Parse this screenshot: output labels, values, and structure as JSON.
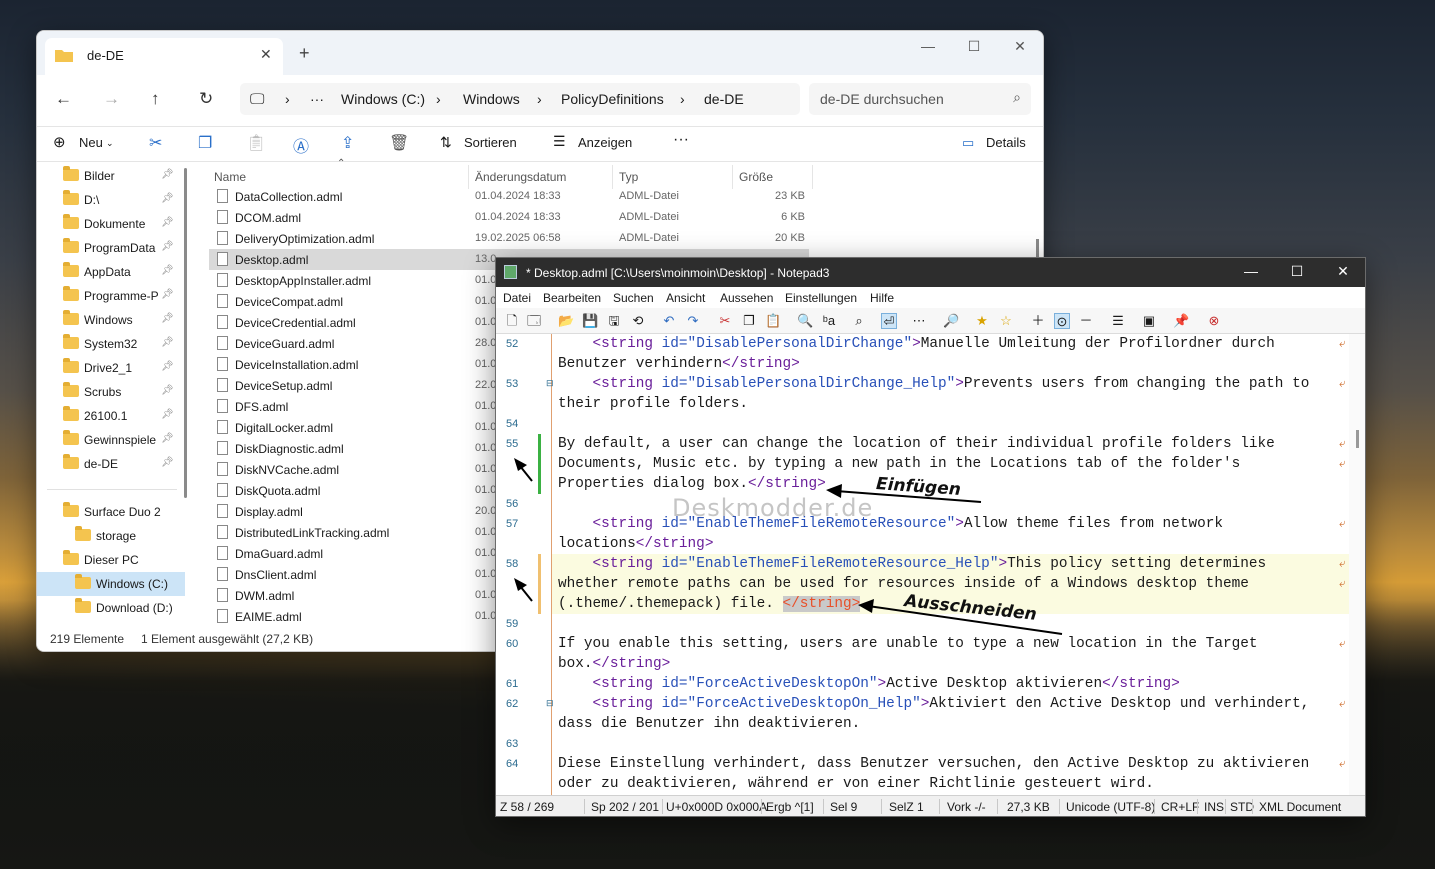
{
  "explorer": {
    "tab_title": "de-DE",
    "breadcrumb": [
      "Windows (C:)",
      "Windows",
      "PolicyDefinitions",
      "de-DE"
    ],
    "search_placeholder": "de-DE durchsuchen",
    "commands": {
      "new": "Neu",
      "sort": "Sortieren",
      "view": "Anzeigen",
      "details": "Details",
      "more": "···"
    },
    "sidebar": [
      {
        "label": "Bilder",
        "pinned": true
      },
      {
        "label": "D:\\",
        "pinned": true
      },
      {
        "label": "Dokumente",
        "pinned": true
      },
      {
        "label": "ProgramData",
        "pinned": true
      },
      {
        "label": "AppData",
        "pinned": true
      },
      {
        "label": "Programme-P",
        "pinned": true
      },
      {
        "label": "Windows",
        "pinned": true
      },
      {
        "label": "System32",
        "pinned": true
      },
      {
        "label": "Drive2_1",
        "pinned": true
      },
      {
        "label": "Scrubs",
        "pinned": true
      },
      {
        "label": "26100.1",
        "pinned": true
      },
      {
        "label": "Gewinnspiele",
        "pinned": true
      },
      {
        "label": "de-DE",
        "pinned": true
      }
    ],
    "sidebar_bottom": [
      {
        "label": "Surface Duo 2"
      },
      {
        "label": "storage"
      },
      {
        "label": "Dieser PC"
      },
      {
        "label": "Windows (C:)",
        "selected": true
      },
      {
        "label": "Download (D:)"
      }
    ],
    "columns": [
      "Name",
      "Änderungsdatum",
      "Typ",
      "Größe"
    ],
    "files": [
      {
        "name": "DataCollection.adml",
        "date": "01.04.2024 18:33",
        "type": "ADML-Datei",
        "size": "23 KB"
      },
      {
        "name": "DCOM.adml",
        "date": "01.04.2024 18:33",
        "type": "ADML-Datei",
        "size": "6 KB"
      },
      {
        "name": "DeliveryOptimization.adml",
        "date": "19.02.2025 06:58",
        "type": "ADML-Datei",
        "size": "20 KB"
      },
      {
        "name": "Desktop.adml",
        "date": "13.0",
        "type": "",
        "size": "",
        "selected": true
      },
      {
        "name": "DesktopAppInstaller.adml",
        "date": "01.0",
        "type": "",
        "size": ""
      },
      {
        "name": "DeviceCompat.adml",
        "date": "01.0",
        "type": "",
        "size": ""
      },
      {
        "name": "DeviceCredential.adml",
        "date": "01.0",
        "type": "",
        "size": ""
      },
      {
        "name": "DeviceGuard.adml",
        "date": "28.0",
        "type": "",
        "size": ""
      },
      {
        "name": "DeviceInstallation.adml",
        "date": "01.0",
        "type": "",
        "size": ""
      },
      {
        "name": "DeviceSetup.adml",
        "date": "22.0",
        "type": "",
        "size": ""
      },
      {
        "name": "DFS.adml",
        "date": "01.0",
        "type": "",
        "size": ""
      },
      {
        "name": "DigitalLocker.adml",
        "date": "01.0",
        "type": "",
        "size": ""
      },
      {
        "name": "DiskDiagnostic.adml",
        "date": "01.0",
        "type": "",
        "size": ""
      },
      {
        "name": "DiskNVCache.adml",
        "date": "01.0",
        "type": "",
        "size": ""
      },
      {
        "name": "DiskQuota.adml",
        "date": "01.0",
        "type": "",
        "size": ""
      },
      {
        "name": "Display.adml",
        "date": "20.0",
        "type": "",
        "size": ""
      },
      {
        "name": "DistributedLinkTracking.adml",
        "date": "01.0",
        "type": "",
        "size": ""
      },
      {
        "name": "DmaGuard.adml",
        "date": "01.0",
        "type": "",
        "size": ""
      },
      {
        "name": "DnsClient.adml",
        "date": "01.0",
        "type": "",
        "size": ""
      },
      {
        "name": "DWM.adml",
        "date": "01.0",
        "type": "",
        "size": ""
      },
      {
        "name": "EAIME.adml",
        "date": "01.0",
        "type": "",
        "size": ""
      }
    ],
    "status_count": "219 Elemente",
    "status_selected": "1 Element ausgewählt (27,2 KB)"
  },
  "notepad": {
    "title": "* Desktop.adml [C:\\Users\\moinmoin\\Desktop] - Notepad3",
    "menu": [
      "Datei",
      "Bearbeiten",
      "Suchen",
      "Ansicht",
      "Aussehen",
      "Einstellungen",
      "Hilfe"
    ],
    "status": {
      "pos": "Z  58 / 269",
      "col": "Sp  202 / 201",
      "char": "U+0x000D 0x000A",
      "find": "Ergb  ^[1]",
      "sel": "Sel  9",
      "sell": "SelZ  1",
      "occ": "Vork  -/-",
      "size": "27,3 KB",
      "enc": "Unicode (UTF-8)",
      "eol": "CR+LF",
      "ins": "INS",
      "std": "STD",
      "lexer": "XML Document"
    },
    "watermark": "Deskmodder.de",
    "annotations": {
      "insert": "Einfügen",
      "cut": "Ausschneiden"
    },
    "lines": [
      {
        "n": "52",
        "wrap": true
      },
      {
        "n": "53",
        "wrap": true
      },
      {
        "n": "54"
      },
      {
        "n": "55",
        "wrap": true
      },
      {
        "n": "56"
      },
      {
        "n": "57",
        "wrap": true
      },
      {
        "n": "58",
        "wrap": true
      },
      {
        "n": "59"
      },
      {
        "n": "60",
        "wrap": true
      },
      {
        "n": "61"
      },
      {
        "n": "62",
        "wrap": true
      },
      {
        "n": "63"
      },
      {
        "n": "64",
        "wrap": true
      }
    ],
    "text": {
      "l52a": "DisablePersonalDirChange",
      "l52b": "Manuelle Umleitung der Profilordner durch",
      "l52c": "Benutzer verhindern",
      "l53a": "DisablePersonalDirChange_Help",
      "l53b": "Prevents users from changing the path to",
      "l53c": "their profile folders.",
      "l55a": "By default, a user can change the location of their individual profile folders like",
      "l55b": "Documents, Music etc. by typing a new path in the Locations tab of the folder's",
      "l55c": "Properties dialog box.",
      "l57a": "EnableThemeFileRemoteResource",
      "l57b": "Allow theme files from network",
      "l57c": "locations",
      "l58a": "EnableThemeFileRemoteResource_Help",
      "l58b": "This policy setting determines",
      "l58c": "whether remote paths can be used for resources inside of a Windows desktop theme",
      "l58d": "(.theme/.themepack) file. ",
      "l60a": "If you enable this setting, users are unable to type a new location in the Target",
      "l60b": "box.",
      "l61a": "ForceActiveDesktopOn",
      "l61b": "Active Desktop aktivieren",
      "l62a": "ForceActiveDesktopOn_Help",
      "l62b": "Aktiviert den Active Desktop und verhindert,",
      "l62c": "dass die Benutzer ihn deaktivieren.",
      "l64a": "Diese Einstellung verhindert, dass Benutzer versuchen, den Active Desktop zu aktivieren",
      "l64b": "oder zu deaktivieren, während er von einer Richtlinie gesteuert wird.",
      "open": "<string",
      "attr": " id=",
      "close": "</string>",
      "gt": ">"
    }
  }
}
